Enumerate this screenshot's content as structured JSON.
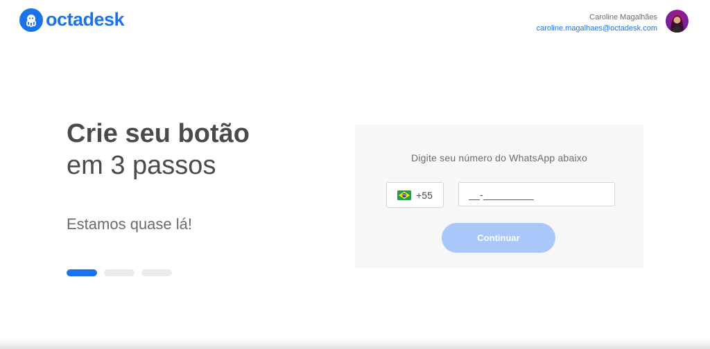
{
  "header": {
    "logo_text": "octadesk",
    "user_name": "Caroline Magalhães",
    "user_email": "caroline.magalhaes@octadesk.com"
  },
  "left": {
    "headline_strong": "Crie seu botão",
    "headline_light": "em 3 passos",
    "subtitle": "Estamos quase lá!",
    "steps_total": 3,
    "steps_current": 1
  },
  "card": {
    "title": "Digite seu número do WhatsApp abaixo",
    "country_code": "+55",
    "country_flag_icon": "brazil-flag-icon",
    "phone_value": "__-_________",
    "continue_label": "Continuar"
  },
  "colors": {
    "brand": "#1a73e8",
    "button_disabled": "#a9c8f9",
    "card_bg": "#f7f7f7"
  }
}
